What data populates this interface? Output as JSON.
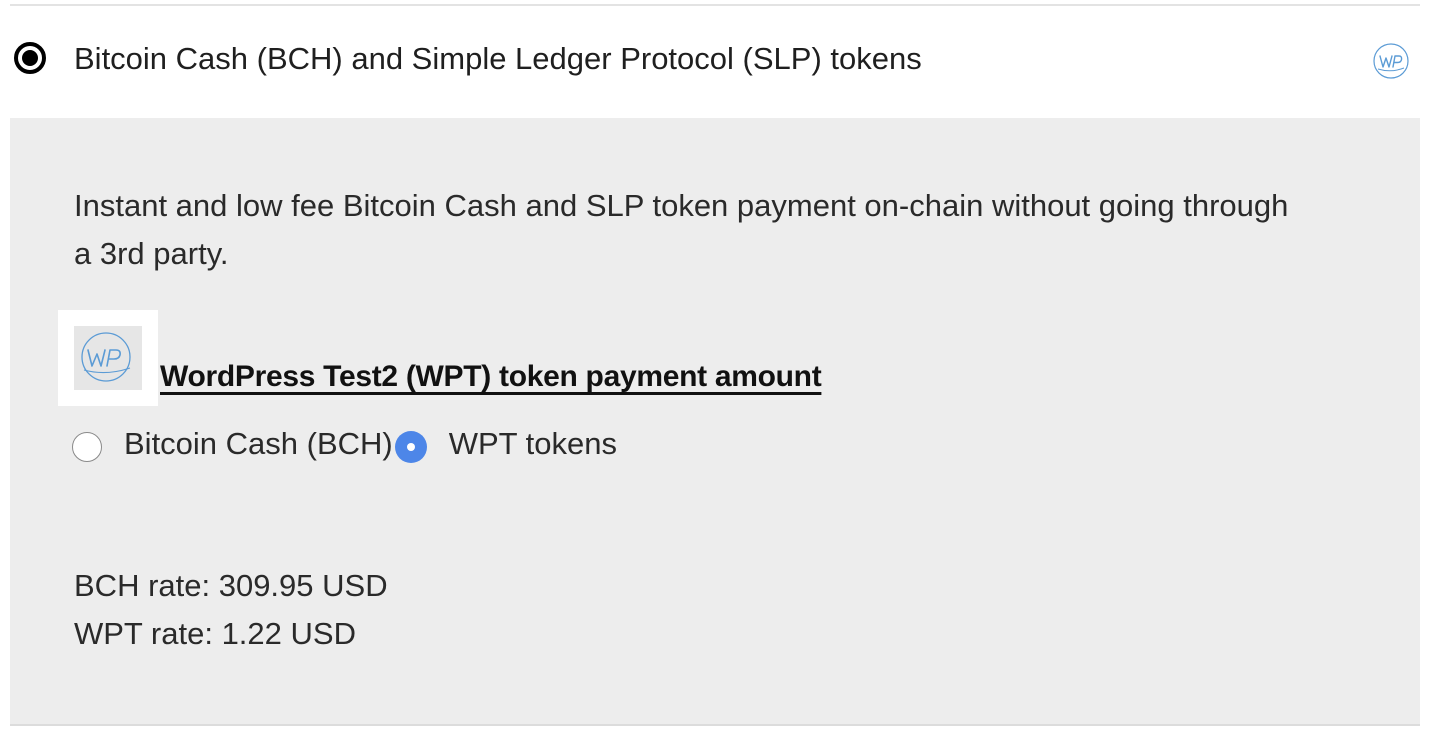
{
  "payment_method": {
    "label": "Bitcoin Cash (BCH) and Simple Ledger Protocol (SLP) tokens",
    "selected": true,
    "logo_icon": "wp-logo-icon"
  },
  "panel": {
    "description": "Instant and low fee Bitcoin Cash and SLP token payment on-chain without going through a 3rd party.",
    "token_logo_icon": "wp-token-logo-icon",
    "token_heading": "WordPress Test2 (WPT) token payment amount",
    "currency_options": [
      {
        "label": "Bitcoin Cash (BCH)",
        "selected": false
      },
      {
        "label": "WPT tokens",
        "selected": true
      }
    ],
    "rates": {
      "bch": "BCH rate: 309.95 USD",
      "wpt": "WPT rate: 1.22 USD"
    }
  },
  "colors": {
    "panel_background": "#ededed",
    "selected_radio": "#4d86e8",
    "logo_blue": "#5b9bd5"
  }
}
